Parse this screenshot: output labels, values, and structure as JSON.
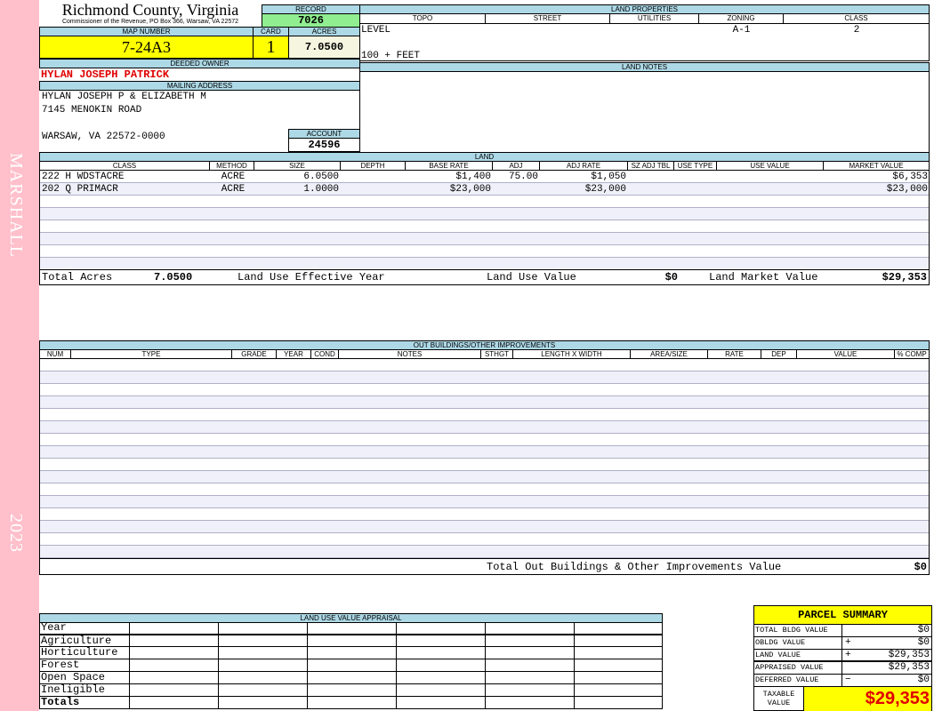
{
  "sidebar": {
    "name": "MARSHALL",
    "year": "2023"
  },
  "header": {
    "title": "Richmond County, Virginia",
    "subtitle": "Commissioner of the Revenue, PO Box 366, Warsaw, VA 22572"
  },
  "record": {
    "label": "RECORD",
    "value": "7026"
  },
  "map": {
    "label": "MAP NUMBER",
    "value": "7-24A3"
  },
  "card": {
    "label": "CARD",
    "value": "1"
  },
  "acres": {
    "label": "ACRES",
    "value": "7.0500"
  },
  "owner": {
    "label": "DEEDED OWNER",
    "value": "HYLAN JOSEPH PATRICK"
  },
  "mailing": {
    "label": "MAILING ADDRESS",
    "line1": "HYLAN JOSEPH P & ELIZABETH M",
    "line2": "7145 MENOKIN ROAD",
    "line3": "WARSAW, VA 22572-0000"
  },
  "account": {
    "label": "ACCOUNT",
    "value": "24596"
  },
  "land_properties": {
    "label": "LAND PROPERTIES",
    "columns": [
      "TOPO",
      "STREET",
      "UTILITIES",
      "ZONING",
      "CLASS"
    ],
    "topo": "LEVEL",
    "topo2": "100 + FEET",
    "zoning": "A-1",
    "class": "2"
  },
  "land_notes": {
    "label": "LAND NOTES"
  },
  "land": {
    "label": "LAND",
    "columns": [
      "CLASS",
      "METHOD",
      "SIZE",
      "DEPTH",
      "BASE RATE",
      "ADJ",
      "ADJ RATE",
      "SZ ADJ TBL",
      "USE TYPE",
      "USE VALUE",
      "MARKET VALUE"
    ],
    "rows": [
      [
        "222 H WDSTACRE",
        "ACRE",
        "6.0500",
        "",
        "$1,400",
        "75.00",
        "$1,050",
        "",
        "",
        "",
        "$6,353"
      ],
      [
        "202 Q PRIMACR",
        "ACRE",
        "1.0000",
        "",
        "$23,000",
        "",
        "$23,000",
        "",
        "",
        "",
        "$23,000"
      ]
    ],
    "totals": {
      "acres_label": "Total Acres",
      "acres": "7.0500",
      "eff_year_label": "Land Use Effective Year",
      "use_value_label": "Land Use Value",
      "use_value": "$0",
      "market_label": "Land Market Value",
      "market": "$29,353"
    }
  },
  "outbuildings": {
    "label": "OUT BUILDINGS/OTHER IMPROVEMENTS",
    "columns": [
      "NUM",
      "TYPE",
      "GRADE",
      "YEAR",
      "COND",
      "NOTES",
      "STHGT",
      "LENGTH X WIDTH",
      "AREA/SIZE",
      "RATE",
      "DEP",
      "VALUE",
      "% COMP"
    ],
    "total_label": "Total Out Buildings & Other Improvements Value",
    "total": "$0"
  },
  "land_use": {
    "label": "LAND USE VALUE APPRAISAL",
    "year_label": "Year",
    "rows": [
      "Agriculture",
      "Horticulture",
      "Forest",
      "Open Space",
      "Ineligible"
    ],
    "totals_label": "Totals"
  },
  "parcel_summary": {
    "title": "PARCEL SUMMARY",
    "rows": [
      {
        "label": "TOTAL BLDG VALUE",
        "op": "",
        "value": "$0"
      },
      {
        "label": "OBLDG VALUE",
        "op": "+",
        "value": "$0"
      },
      {
        "label": "LAND VALUE",
        "op": "+",
        "value": "$29,353"
      },
      {
        "label": "APPRAISED VALUE",
        "op": "",
        "value": "$29,353"
      },
      {
        "label": "DEFERRED VALUE",
        "op": "−",
        "value": "$0"
      }
    ],
    "taxable_label": "TAXABLE VALUE",
    "taxable": "$29,353"
  },
  "colors": {
    "header": "#add8e6",
    "record": "#90ee90",
    "highlight": "#ffff00",
    "owner": "#e00000",
    "sidebar": "#ffc0cb"
  }
}
